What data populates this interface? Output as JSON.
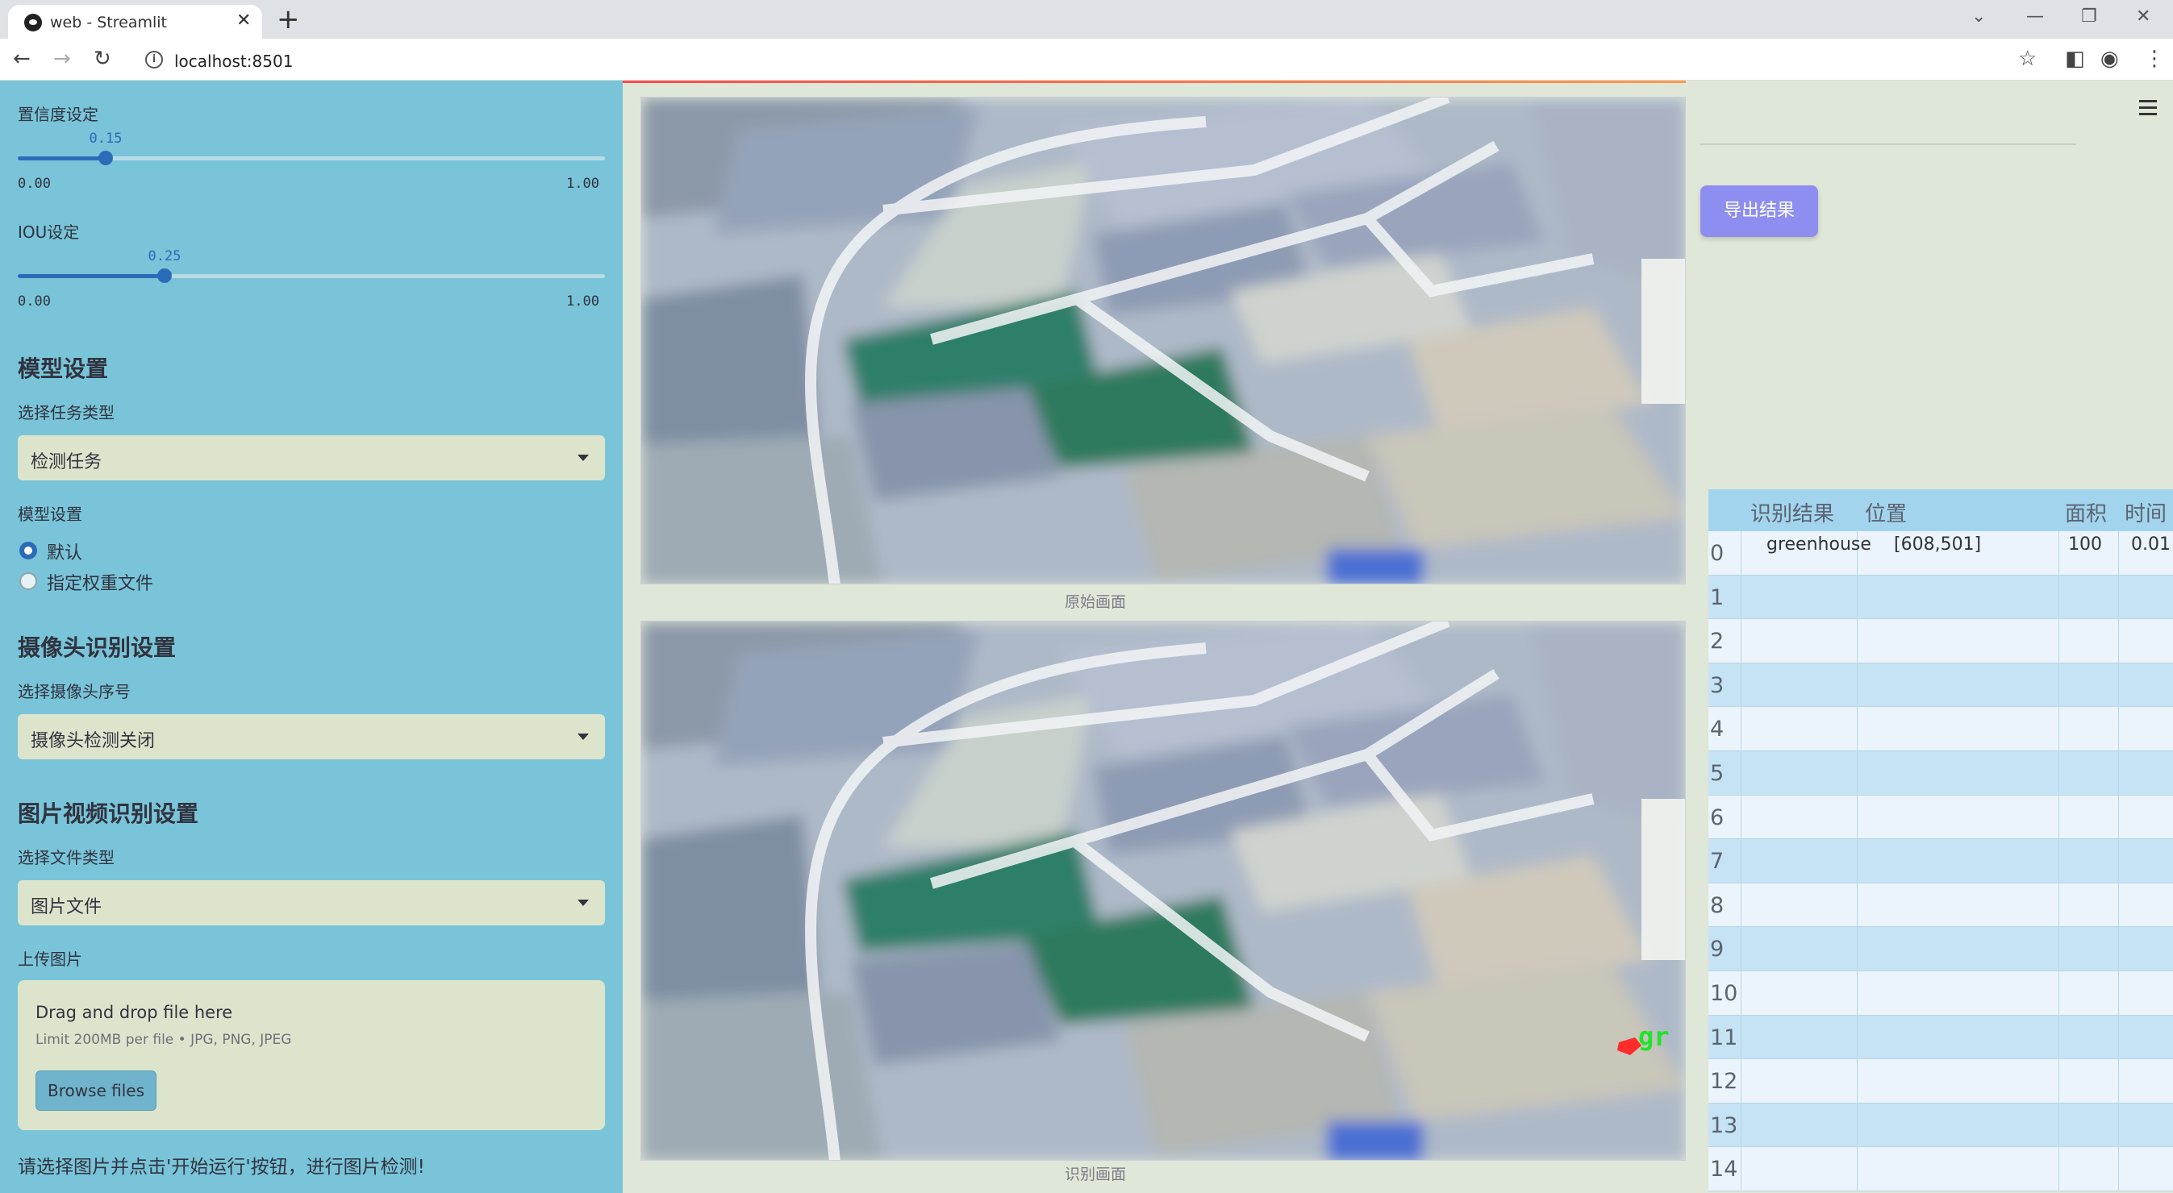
{
  "browser": {
    "tab_title": "web - Streamlit",
    "url": "localhost:8501"
  },
  "sidebar": {
    "confidence": {
      "label": "置信度设定",
      "value": "0.15",
      "fraction": 0.15,
      "min": "0.00",
      "max": "1.00"
    },
    "iou": {
      "label": "IOU设定",
      "value": "0.25",
      "fraction": 0.25,
      "min": "0.00",
      "max": "1.00"
    },
    "model_section": "模型设置",
    "task_label": "选择任务类型",
    "task_value": "检测任务",
    "model_label": "模型设置",
    "model_options": [
      "默认",
      "指定权重文件"
    ],
    "camera_section": "摄像头识别设置",
    "camera_label": "选择摄像头序号",
    "camera_value": "摄像头检测关闭",
    "media_section": "图片视频识别设置",
    "file_type_label": "选择文件类型",
    "file_type_value": "图片文件",
    "upload_label": "上传图片",
    "uploader": {
      "title": "Drag and drop file here",
      "limit": "Limit 200MB per file • JPG, PNG, JPEG",
      "button": "Browse files"
    },
    "footer_hint": "请选择图片并点击'开始运行'按钮，进行图片检测!"
  },
  "main": {
    "original_caption": "原始画面",
    "result_caption": "识别画面",
    "detection_text": "gr"
  },
  "right": {
    "export_button": "导出结果",
    "table": {
      "headers": [
        "识别结果",
        "位置",
        "面积",
        "时间"
      ],
      "rows": [
        {
          "index": "0",
          "result": "greenhouse",
          "position": "[608,501]",
          "area": "100",
          "time": "0.01"
        },
        {
          "index": "1"
        },
        {
          "index": "2"
        },
        {
          "index": "3"
        },
        {
          "index": "4"
        },
        {
          "index": "5"
        },
        {
          "index": "6"
        },
        {
          "index": "7"
        },
        {
          "index": "8"
        },
        {
          "index": "9"
        },
        {
          "index": "10"
        },
        {
          "index": "11"
        },
        {
          "index": "12"
        },
        {
          "index": "13"
        },
        {
          "index": "14"
        }
      ]
    }
  },
  "colors": {
    "sidebar_bg": "#79c4d9",
    "accent": "#2b6cb8",
    "export_button": "#8e8ef0",
    "table_header": "#a3d4ee"
  }
}
